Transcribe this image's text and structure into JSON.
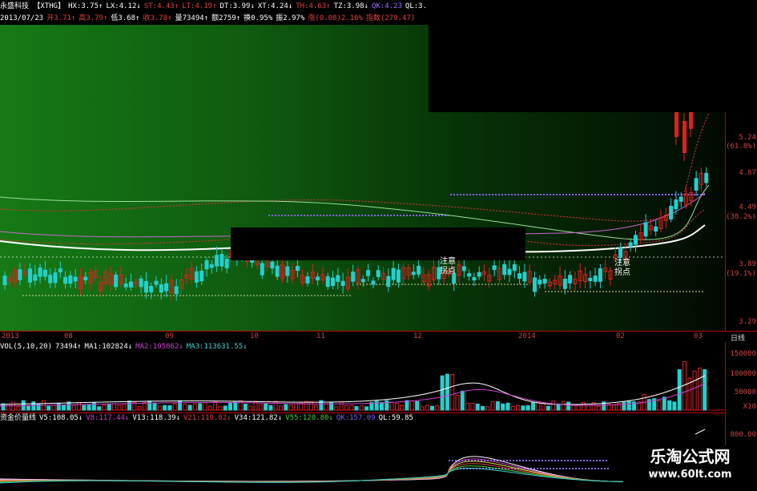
{
  "header": {
    "line1": [
      {
        "text": "永盛科技 【XTHG】",
        "color": "#ffffff"
      },
      {
        "text": "HX:3.75↑",
        "color": "#ffffff"
      },
      {
        "text": "LX:4.12↓",
        "color": "#ffffff"
      },
      {
        "text": "ST:4.43↑",
        "color": "#e04040"
      },
      {
        "text": "LT:4.19↑",
        "color": "#e04040"
      },
      {
        "text": "DT:3.99↓",
        "color": "#ffffff"
      },
      {
        "text": "XT:4.24↓",
        "color": "#ffffff"
      },
      {
        "text": "TH:4.63↑",
        "color": "#e04040"
      },
      {
        "text": "TZ:3.98↓",
        "color": "#ffffff"
      },
      {
        "text": "QK:4.23",
        "color": "#9a6cff"
      },
      {
        "text": "QL:3.",
        "color": "#ffffff"
      }
    ],
    "line2": [
      {
        "text": "2013/07/23",
        "color": "#ffffff"
      },
      {
        "text": "开3.71↑",
        "color": "#e04040"
      },
      {
        "text": "高3.79↑",
        "color": "#e04040"
      },
      {
        "text": "低3.68↑",
        "color": "#ffffff"
      },
      {
        "text": "收3.78↑",
        "color": "#e04040"
      },
      {
        "text": "量73494↑",
        "color": "#ffffff"
      },
      {
        "text": "额2759↑",
        "color": "#ffffff"
      },
      {
        "text": "换0.95%",
        "color": "#ffffff"
      },
      {
        "text": "振2.97%",
        "color": "#ffffff"
      },
      {
        "text": "涨(0.08)2.16%",
        "color": "#e04040"
      },
      {
        "text": "指数(279.47)",
        "color": "#e04040"
      }
    ]
  },
  "price_axis": [
    "5.24",
    "(61.8%)",
    "4.87",
    "4.49",
    "(38.2%)",
    "3.89",
    "(19.1%)",
    "3.29"
  ],
  "time_axis": {
    "labels": [
      "2013",
      "08",
      "09",
      "10",
      "11",
      "12",
      "2014",
      "02",
      "03"
    ],
    "period": "日线"
  },
  "annotations": [
    {
      "l1": "注意",
      "l2": "拐点"
    },
    {
      "l1": "注意",
      "l2": "拐点"
    }
  ],
  "volume": {
    "header": [
      {
        "text": "VOL(5,10,20)",
        "color": "#ffffff"
      },
      {
        "text": "73494↑",
        "color": "#ffffff"
      },
      {
        "text": "MA1:102824↓",
        "color": "#ffffff"
      },
      {
        "text": "MA2:105862↓",
        "color": "#d040d0"
      },
      {
        "text": "MA3:113631.55↓",
        "color": "#40d0d0"
      }
    ],
    "axis": [
      "150000",
      "100000",
      "50000",
      "X10"
    ]
  },
  "flow": {
    "header": [
      {
        "text": "资金价量线",
        "color": "#ffffff"
      },
      {
        "text": "V5:108.05↓",
        "color": "#ffffff"
      },
      {
        "text": "V8:117.44↓",
        "color": "#d040d0"
      },
      {
        "text": "V13:118.39↓",
        "color": "#ffffff"
      },
      {
        "text": "V21:119.02↓",
        "color": "#e04040"
      },
      {
        "text": "V34:121.82↓",
        "color": "#ffffff"
      },
      {
        "text": "V55:120.80↓",
        "color": "#40d040"
      },
      {
        "text": "QK:157.09",
        "color": "#7060ff"
      },
      {
        "text": "QL:59.85",
        "color": "#ffffff"
      }
    ],
    "axis": [
      "800.00"
    ]
  },
  "watermark": {
    "title": "乐淘公式网",
    "url": "www.60lt.com"
  },
  "colors": {
    "up": "#e02020",
    "down": "#22d0d0",
    "grid": "#b00000"
  }
}
